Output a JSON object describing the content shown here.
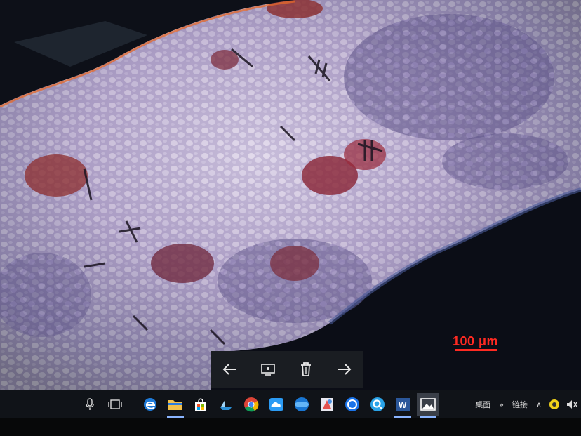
{
  "photo": {
    "description_free": true,
    "scale_bar_label": "100 μm",
    "scale_color": "#ff2a22"
  },
  "viewer_toolbar": {
    "prev_icon": "arrow-left-icon",
    "info_icon": "slideshow-icon",
    "delete_icon": "trash-icon",
    "next_icon": "arrow-right-icon"
  },
  "taskbar": {
    "tray_desktop_label": "桌面",
    "tray_links_label": "链接",
    "icons": [
      "microphone-icon",
      "task-view-icon",
      "edge-icon",
      "file-explorer-icon",
      "store-icon",
      "ship-icon",
      "chrome-icon",
      "cloud-icon",
      "globe-icon",
      "paint-icon",
      "circle-app-icon",
      "search-q-icon",
      "word-icon",
      "photos-icon"
    ]
  }
}
